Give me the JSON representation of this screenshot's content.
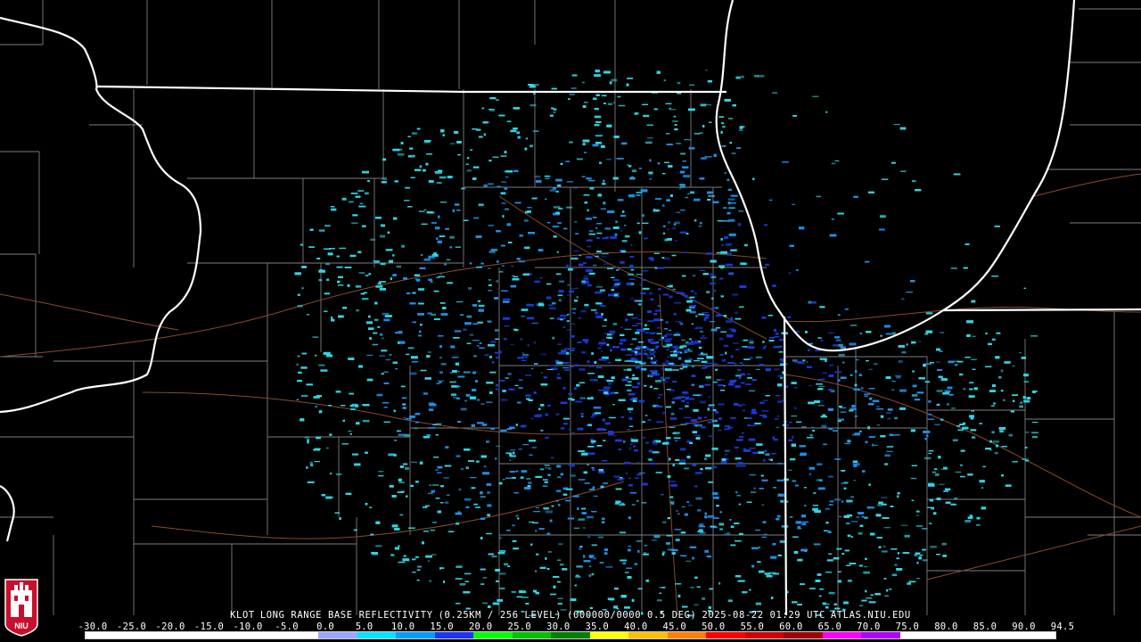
{
  "product": {
    "station": "KLOT",
    "product_name": "LONG RANGE BASE REFLECTIVITY",
    "resolution": "(0.25KM / 256 LEVEL)",
    "volume": "(000000/0000 0.5 DEG)",
    "datetime": "2025-08-22 01:29 UTC",
    "source": "ATLAS.NIU.EDU"
  },
  "logo": {
    "text": "NIU",
    "color": "#c8102e"
  },
  "color_scale": {
    "labels": [
      "-30.0",
      "-25.0",
      "-20.0",
      "-15.0",
      "-10.0",
      "-5.0",
      "0.0",
      "5.0",
      "10.0",
      "15.0",
      "20.0",
      "25.0",
      "30.0",
      "35.0",
      "40.0",
      "45.0",
      "50.0",
      "55.0",
      "60.0",
      "65.0",
      "70.0",
      "75.0",
      "80.0",
      "85.0",
      "90.0",
      "94.5"
    ],
    "colors": [
      "#ffffff",
      "#ffffff",
      "#ffffff",
      "#ffffff",
      "#ffffff",
      "#ffffff",
      "#9aa7ff",
      "#00e5ff",
      "#00a0ff",
      "#1e32ff",
      "#00ff00",
      "#00c000",
      "#008000",
      "#ffff00",
      "#ffc000",
      "#ff8000",
      "#ff0000",
      "#d00000",
      "#a00000",
      "#ff00ff",
      "#b000ff",
      "#ffffff",
      "#ffffff",
      "#ffffff",
      "#ffffff"
    ]
  },
  "map_colors": {
    "background": "#000000",
    "state_border": "#ffffff",
    "county_border": "#8c8c8c",
    "road": "#8b4a2b",
    "echo_light": "#2fd7e6",
    "echo_mid": "#1f8fe8",
    "echo_strong": "#1a3ad8"
  }
}
